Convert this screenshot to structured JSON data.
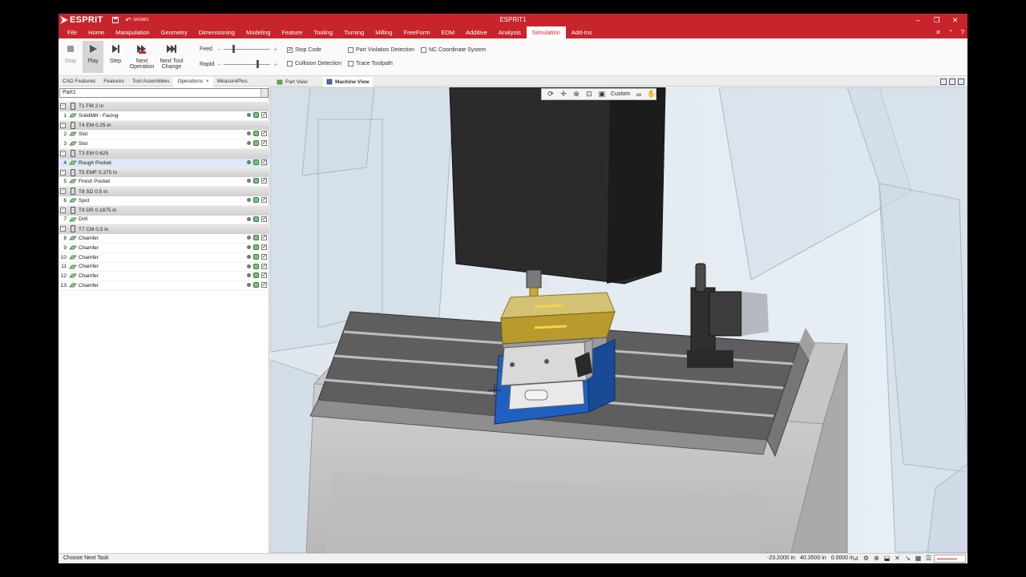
{
  "app": {
    "logo_text": "ESPRIT",
    "window_title": "ESPRIT1",
    "qat_g": "G01",
    "qat_m": "M01"
  },
  "menu": {
    "items": [
      "File",
      "Home",
      "Manipulation",
      "Geometry",
      "Dimensioning",
      "Modeling",
      "Feature",
      "Tooling",
      "Turning",
      "Milling",
      "FreeForm",
      "EDM",
      "Additive",
      "Analysis",
      "Simulation",
      "Add-Ins"
    ],
    "active": "Simulation"
  },
  "ribbon": {
    "stop": "Stop",
    "play": "Play",
    "step": "Step",
    "next_op_1": "Next",
    "next_op_2": "Operation",
    "next_tool_1": "Next Tool",
    "next_tool_2": "Change",
    "feed_label": "Feed",
    "rapid_label": "Rapid",
    "feed_level": 0.2,
    "rapid_level": 0.75,
    "checks": {
      "stop_code": {
        "label": "Stop Code",
        "checked": true
      },
      "collision": {
        "label": "Collision Detection",
        "checked": false
      },
      "part_violation": {
        "label": "Part Violation Detection",
        "checked": false
      },
      "trace_toolpath": {
        "label": "Trace Toolpath",
        "checked": false
      },
      "nc_coord": {
        "label": "NC Coordinate System",
        "checked": false
      }
    }
  },
  "panel": {
    "tabs": [
      "CAD Features",
      "Features",
      "Tool Assemblies",
      "Operations",
      "MeasurePlus"
    ],
    "active_tab": "Operations",
    "close_glyph": "×",
    "part": "Part1"
  },
  "operations": [
    {
      "tool": "T1 FM 2 in",
      "ops": [
        {
          "n": "1",
          "name": "SolidMill - Facing"
        }
      ]
    },
    {
      "tool": "T4 EM 0.25 in",
      "ops": [
        {
          "n": "2",
          "name": "Slot"
        },
        {
          "n": "3",
          "name": "Slot"
        }
      ]
    },
    {
      "tool": "T3 EM 0.625",
      "ops": [
        {
          "n": "4",
          "name": "Rough Pocket",
          "selected": true
        }
      ]
    },
    {
      "tool": "T5 EMF 0.375 in",
      "ops": [
        {
          "n": "5",
          "name": "Finish Pocket"
        }
      ]
    },
    {
      "tool": "T8 SD 0.5 in",
      "ops": [
        {
          "n": "6",
          "name": "Spot"
        }
      ]
    },
    {
      "tool": "T9 DR 0.1875 in",
      "ops": [
        {
          "n": "7",
          "name": "Drill"
        }
      ]
    },
    {
      "tool": "T7 CM 0.5 in",
      "ops": [
        {
          "n": "8",
          "name": "Chamfer"
        },
        {
          "n": "9",
          "name": "Chamfer"
        },
        {
          "n": "10",
          "name": "Chamfer"
        },
        {
          "n": "11",
          "name": "Chamfer"
        },
        {
          "n": "12",
          "name": "Chamfer"
        },
        {
          "n": "13",
          "name": "Chamfer"
        }
      ]
    }
  ],
  "views": {
    "part_view": "Part View",
    "machine_view": "Machine View",
    "view_mode": "Custom"
  },
  "status": {
    "message": "Choose Next Task",
    "x": "-23.2000 in",
    "y": "40.3500 in",
    "z": "0.0000 in"
  },
  "colors": {
    "accent": "#c8242c",
    "part_gold": "#b99a2c",
    "vise_blue": "#1f5fbf",
    "table_gray": "#5e5e5e",
    "spindle": "#2b2b2b"
  }
}
